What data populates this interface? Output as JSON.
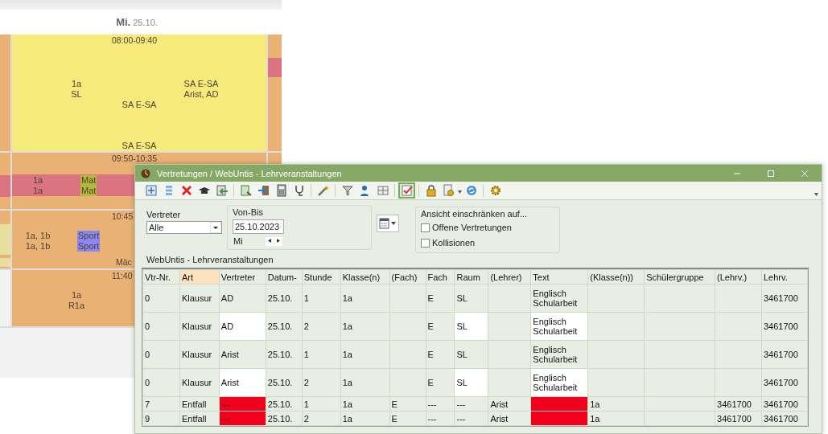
{
  "timetable": {
    "day": "Mi.",
    "date": "25.10.",
    "blocks": [
      {
        "kind": "exam",
        "color": "#f6ea7b",
        "time": "08:00-09:40",
        "columns": [
          {
            "lines": [
              "1a",
              "SL"
            ]
          },
          {
            "lines": [
              "SA E-SA",
              "Arist, AD"
            ]
          }
        ],
        "middle": "SA E-SA",
        "footer": "SA E-SA"
      },
      {
        "kind": "band",
        "color": "#e9b274",
        "band": {
          "color": "#d97480"
        },
        "time": "09:50-10:35",
        "columns": [
          {
            "lines": [
              "1a",
              "1a"
            ]
          },
          {
            "lines": [
              "Mat",
              "Mat"
            ],
            "color": "#b5b83a"
          }
        ]
      },
      {
        "kind": "lesson",
        "color": "#e9b274",
        "time": "10:45",
        "columns": [
          {
            "lines": [
              "1a, 1b",
              "1a, 1b"
            ]
          },
          {
            "lines": [
              "Sport",
              "Sport"
            ],
            "color": "#8a86f2"
          }
        ],
        "footer": "Mäc"
      },
      {
        "kind": "lesson",
        "color": "#e9b274",
        "time": "11:40",
        "columns": [
          {
            "lines": [
              "1a",
              "R1a"
            ]
          }
        ]
      }
    ]
  },
  "window": {
    "title": "Vertretungen / WebUntis - Lehrveranstaltungen",
    "toolbar": [
      {
        "pressed": false
      },
      {
        "pressed": false
      },
      {
        "pressed": false
      },
      {
        "pressed": false
      },
      {
        "pressed": false
      },
      {
        "pressed": false
      },
      {
        "pressed": false
      },
      {
        "pressed": false
      },
      {
        "pressed": false
      },
      {
        "pressed": false
      },
      {
        "pressed": false
      },
      {
        "pressed": false
      },
      {
        "pressed": false
      },
      {
        "pressed": true
      },
      {
        "pressed": false
      },
      {
        "pressed": false
      },
      {
        "pressed": false
      },
      {
        "pressed": false
      }
    ],
    "filters": {
      "substitute": {
        "label": "Vertreter",
        "value": "Alle"
      },
      "range": {
        "label": "Von-Bis",
        "date": "25.10.2023",
        "weekday": "Mi"
      },
      "restrict": {
        "label": "Ansicht einschränken auf...",
        "options": [
          {
            "label": "Offene Vertretungen",
            "checked": false
          },
          {
            "label": "Kollisionen",
            "checked": false
          }
        ]
      }
    },
    "caption": "WebUntis - Lehrveranstaltungen",
    "table": {
      "columns": [
        {
          "label": "Vtr-Nr.",
          "selected": false
        },
        {
          "label": "Art",
          "selected": true
        },
        {
          "label": "Vertreter",
          "selected": false
        },
        {
          "label": "Datum-",
          "selected": false
        },
        {
          "label": "Stunde",
          "selected": false
        },
        {
          "label": "Klasse(n)",
          "selected": false
        },
        {
          "label": "(Fach)",
          "selected": false
        },
        {
          "label": "Fach",
          "selected": false
        },
        {
          "label": "Raum",
          "selected": false
        },
        {
          "label": "(Lehrer)",
          "selected": false
        },
        {
          "label": "Text",
          "selected": false
        },
        {
          "label": "(Klasse(n))",
          "selected": false
        },
        {
          "label": "Schülergruppe",
          "selected": false
        },
        {
          "label": "(Lehrv.)",
          "selected": false
        },
        {
          "label": "Lehrv.",
          "selected": false
        }
      ],
      "rows": [
        {
          "cells": [
            "0",
            "Klausur",
            "AD",
            "25.10.",
            "1",
            "1a",
            null,
            "E",
            "SL",
            null,
            "Englisch Schularbeit",
            null,
            null,
            null,
            "3461700"
          ]
        },
        {
          "cells": [
            "0",
            "Klausur",
            {
              "text": "AD",
              "highlighted": true
            },
            "25.10.",
            "2",
            "1a",
            null,
            "E",
            {
              "text": "SL",
              "highlighted": true
            },
            null,
            {
              "text": "Englisch Schularbeit",
              "highlighted": true
            },
            null,
            null,
            null,
            "3461700"
          ]
        },
        {
          "cells": [
            "0",
            "Klausur",
            "Arist",
            "25.10.",
            "1",
            "1a",
            null,
            "E",
            "SL",
            null,
            "Englisch Schularbeit",
            null,
            null,
            null,
            "3461700"
          ]
        },
        {
          "cells": [
            "0",
            "Klausur",
            {
              "text": "Arist",
              "highlighted": true
            },
            "25.10.",
            "2",
            "1a",
            null,
            "E",
            {
              "text": "SL",
              "highlighted": true
            },
            null,
            {
              "text": "Englisch Schularbeit",
              "highlighted": true
            },
            null,
            null,
            null,
            "3461700"
          ]
        },
        {
          "cells": [
            "7",
            "Entfall",
            {
              "text": "---",
              "conflict": true
            },
            "25.10.",
            "1",
            "1a",
            "E",
            "---",
            "---",
            "Arist",
            {
              "conflict": true
            },
            "1a",
            null,
            "3461700",
            "3461700"
          ]
        },
        {
          "cells": [
            "9",
            "Entfall",
            {
              "text": "---",
              "conflict": true
            },
            "25.10.",
            "2",
            "1a",
            "E",
            "---",
            "---",
            "Arist",
            {
              "conflict": true
            },
            "1a",
            null,
            "3461700",
            "3461700"
          ]
        }
      ]
    }
  }
}
